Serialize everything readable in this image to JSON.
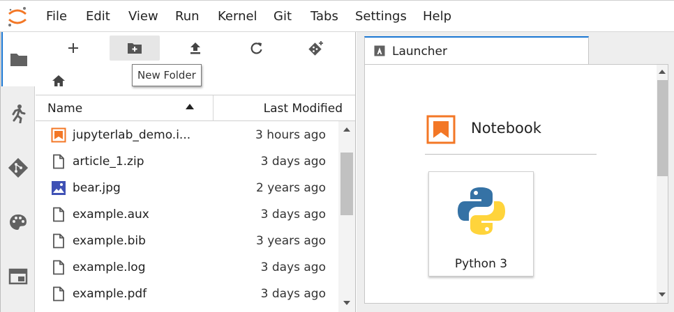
{
  "menu": [
    "File",
    "Edit",
    "View",
    "Run",
    "Kernel",
    "Git",
    "Tabs",
    "Settings",
    "Help"
  ],
  "sidebar": {
    "items": [
      {
        "icon": "folder-icon",
        "active": true
      },
      {
        "icon": "running-icon",
        "active": false
      },
      {
        "icon": "git-icon",
        "active": false
      },
      {
        "icon": "palette-icon",
        "active": false
      },
      {
        "icon": "tabs-icon",
        "active": false
      }
    ]
  },
  "filebrowser": {
    "tooltip": "New Folder",
    "columns": {
      "name": "Name",
      "modified": "Last Modified"
    },
    "files": [
      {
        "name": "jupyterlab_demo.i...",
        "modified": "3 hours ago",
        "icon": "notebook-icon"
      },
      {
        "name": "article_1.zip",
        "modified": "3 days ago",
        "icon": "file-icon"
      },
      {
        "name": "bear.jpg",
        "modified": "2 years ago",
        "icon": "image-icon"
      },
      {
        "name": "example.aux",
        "modified": "3 days ago",
        "icon": "file-icon"
      },
      {
        "name": "example.bib",
        "modified": "3 years ago",
        "icon": "file-icon"
      },
      {
        "name": "example.log",
        "modified": "3 days ago",
        "icon": "file-icon"
      },
      {
        "name": "example.pdf",
        "modified": "3 days ago",
        "icon": "file-icon"
      }
    ]
  },
  "launcher": {
    "tab_title": "Launcher",
    "section_title": "Notebook",
    "kernel_label": "Python 3"
  },
  "colors": {
    "accent": "#1976d2",
    "notebook_orange": "#f37726",
    "image_blue": "#3f51b5"
  }
}
